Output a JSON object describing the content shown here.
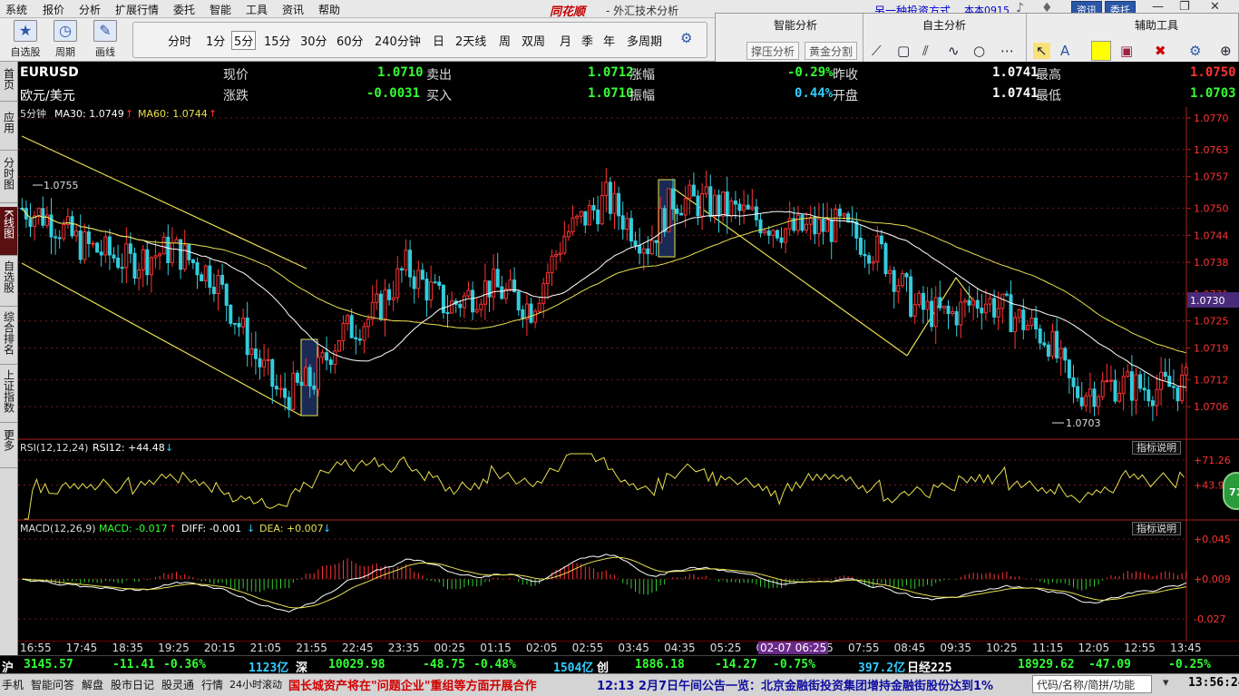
{
  "menubar": {
    "items": [
      "系统",
      "报价",
      "分析",
      "扩展行情",
      "委托",
      "智能",
      "工具",
      "资讯",
      "帮助"
    ],
    "brand": "同花顺",
    "window_title": "- 外汇技术分析",
    "right_label": "另一种投资方式",
    "user": "本本0915",
    "news_btn": "资讯",
    "trade_btn": "委托"
  },
  "toolbar": {
    "big": [
      "自选股",
      "周期",
      "画线"
    ],
    "periods": [
      "分时",
      "1分",
      "5分",
      "15分",
      "30分",
      "60分",
      "240分钟",
      "日",
      "2天线",
      "周",
      "双周",
      "月",
      "季",
      "年",
      "多周期"
    ],
    "selected_period": "5分"
  },
  "tools": {
    "smart_title": "智能分析",
    "self_title": "自主分析",
    "aux_title": "辅助工具",
    "btn_support": "撑压分析",
    "btn_golden": "黄金分割"
  },
  "sidebar": [
    "首页",
    "应用",
    "分时图",
    "K线图",
    "自选股",
    "综合排名",
    "上证指数",
    "更多"
  ],
  "quote": {
    "code": "EURUSD",
    "name": "欧元/美元",
    "now_label": "现价",
    "now": "1.0710",
    "chg_label": "涨跌",
    "chg": "-0.0031",
    "sell_label": "卖出",
    "sell": "1.0712",
    "buy_label": "买入",
    "buy": "1.0710",
    "pct_label": "涨幅",
    "pct": "-0.29%",
    "amp_label": "振幅",
    "amp": "0.44%",
    "prev_label": "昨收",
    "prev": "1.0741",
    "open_label": "开盘",
    "open": "1.0741",
    "high_label": "最高",
    "high": "1.0750",
    "low_label": "最低",
    "low": "1.0703"
  },
  "main_legend": {
    "period": "5分钟",
    "ma30": "MA30: 1.0749",
    "ma60": "MA60: 1.0744"
  },
  "rsi_legend": {
    "name": "RSI(12,12,24)",
    "rsi12": "RSI12: +44.48"
  },
  "macd_legend": {
    "name": "MACD(12,26,9)",
    "macd": "MACD: -0.017",
    "diff": "DIFF: -0.001",
    "dea": "DEA: +0.007"
  },
  "explain_btn": "指标说明",
  "badge": "71",
  "colors": {
    "up": "#ff3333",
    "down": "#33ccdd",
    "ma30": "#ffffff",
    "ma60": "#e8e050",
    "grid": "#7a1a1a",
    "value": "#33ff33"
  },
  "chart_data": {
    "type": "candlestick",
    "y_ticks": [
      "1.0770",
      "1.0763",
      "1.0757",
      "1.0750",
      "1.0744",
      "1.0738",
      "1.0731",
      "1.0725",
      "1.0719",
      "1.0712",
      "1.0706"
    ],
    "ylim": [
      1.07,
      1.077
    ],
    "current_price": "1.0730",
    "high_marker": "1.0755",
    "low_marker": "1.0703",
    "rsi_ticks": [
      "+71.26",
      "+43.93"
    ],
    "macd_ticks": [
      "+0.045",
      "+0.009",
      "-0.027"
    ],
    "x_labels": [
      "16:55",
      "17:45",
      "18:35",
      "19:25",
      "20:15",
      "21:05",
      "21:55",
      "22:45",
      "23:35",
      "00:25",
      "01:15",
      "02:05",
      "02:55",
      "03:45",
      "04:35",
      "05:25",
      "06:15",
      "07:05",
      "07:55",
      "08:45",
      "09:35",
      "10:25",
      "11:15",
      "12:05",
      "12:55",
      "13:45"
    ],
    "cursor_label": "02-07 06:25",
    "close_anchors": [
      [
        0,
        1.075
      ],
      [
        6,
        1.0748
      ],
      [
        14,
        1.0742
      ],
      [
        26,
        1.0738
      ],
      [
        36,
        1.0741
      ],
      [
        46,
        1.0735
      ],
      [
        56,
        1.0717
      ],
      [
        62,
        1.0708
      ],
      [
        70,
        1.0712
      ],
      [
        76,
        1.0722
      ],
      [
        84,
        1.0726
      ],
      [
        92,
        1.0737
      ],
      [
        102,
        1.0728
      ],
      [
        112,
        1.0733
      ],
      [
        122,
        1.0728
      ],
      [
        130,
        1.0744
      ],
      [
        140,
        1.0752
      ],
      [
        150,
        1.0742
      ],
      [
        156,
        1.0752
      ],
      [
        164,
        1.0751
      ],
      [
        172,
        1.0749
      ],
      [
        184,
        1.0745
      ],
      [
        196,
        1.0746
      ],
      [
        206,
        1.074
      ],
      [
        214,
        1.0728
      ],
      [
        222,
        1.0726
      ],
      [
        230,
        1.073
      ],
      [
        238,
        1.0726
      ],
      [
        246,
        1.0721
      ],
      [
        252,
        1.0709
      ],
      [
        262,
        1.0711
      ],
      [
        272,
        1.071
      ],
      [
        279,
        1.0711
      ]
    ]
  },
  "xaxis_note": "",
  "index_bar": {
    "sh_label": "沪",
    "sh": "3145.57",
    "sh_chg": "-11.41",
    "sh_pct": "-0.36%",
    "sh_amt": "1123亿",
    "sz_label": "深",
    "sz": "10029.98",
    "sz_chg": "-48.75",
    "sz_pct": "-0.48%",
    "sz_amt": "1504亿",
    "cy_label": "创",
    "cy": "1886.18",
    "cy_chg": "-14.27",
    "cy_pct": "-0.75%",
    "cy_amt": "397.2亿",
    "nk_label": "日经225",
    "nk": "18929.62",
    "nk_chg": "-47.09",
    "nk_pct": "-0.25%"
  },
  "status": {
    "items": [
      "手机",
      "智能问答",
      "解盘",
      "股市日记",
      "股灵通",
      "行情",
      "24小时滚动"
    ],
    "news1": "国长城资产将在\"问题企业\"重组等方面开展合作",
    "news2": "12:13 2月7日午间公告一览：北京金融街投资集团增持金融街股份达到1%",
    "search_placeholder": "代码/名称/简拼/功能",
    "time": "13:56:24"
  }
}
